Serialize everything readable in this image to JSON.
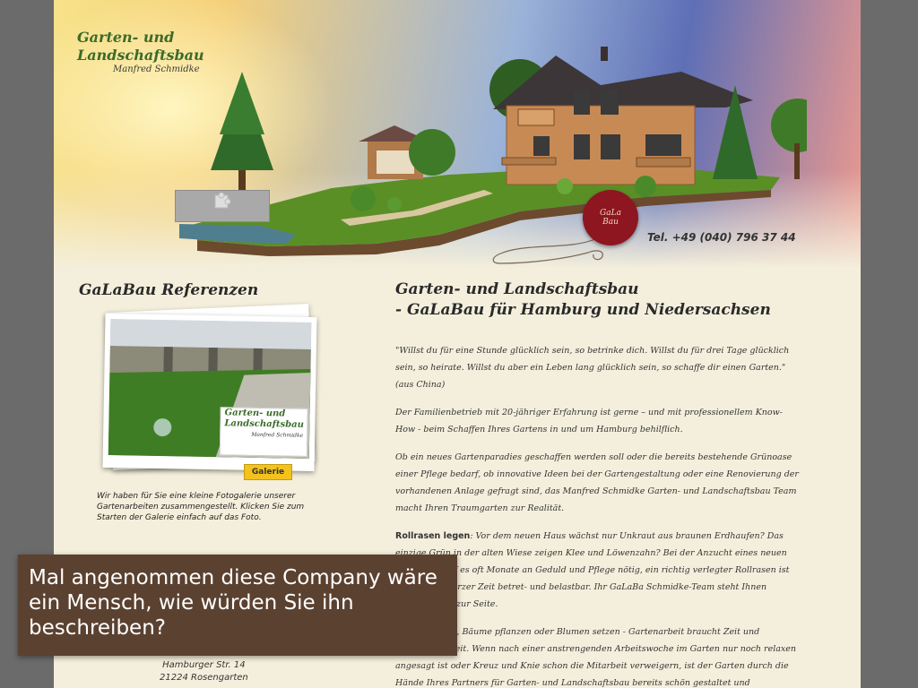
{
  "header": {
    "logo_line1": "Garten- und",
    "logo_line2": "Landschaftsbau",
    "logo_sub": "Manfred Schmidke",
    "phone": "Tel. +49 (040) 796 37 44",
    "seal_text": "GaLa Bau",
    "plugin_icon": "puzzle-icon"
  },
  "left": {
    "title": "GaLaBau Referenzen",
    "photo_logo_line1": "Garten- und",
    "photo_logo_line2": "Landschaftsbau",
    "photo_logo_sub": "Manfred Schmidke",
    "galerie_label": "Galerie",
    "description": "Wir haben für Sie eine kleine Fotogalerie unserer Gartenarbeiten zusammengestellt. Klicken Sie zum Starten der Galerie einfach auf das Foto.",
    "address_line1": "Hamburger Str. 14",
    "address_line2": "21224 Rosengarten"
  },
  "main": {
    "title_line1": "Garten- und Landschaftsbau",
    "title_line2": "- GaLaBau für Hamburg und Niedersachsen",
    "quote": "\"Willst du für eine Stunde glücklich sein, so betrinke dich. Willst du für drei Tage glücklich sein, so heirate. Willst du aber ein Leben lang glücklich sein, so schaffe dir einen Garten.\"(aus China)",
    "para1": "Der Familienbetrieb mit 20-jähriger Erfahrung ist gerne – und mit professionellem Know-How - beim Schaffen Ihres Gartens in und um Hamburg behilflich.",
    "para2": "Ob ein neues Gartenparadies geschaffen werden soll oder die bereits bestehende Grünoase einer Pflege bedarf, ob innovative Ideen bei der Gartengestaltung oder eine Renovierung der vorhandenen Anlage gefragt sind, das Manfred Schmidke Garten- und Landschaftsbau Team macht Ihren Traumgarten zur Realität.",
    "para3_bold": "Rollrasen legen",
    "para3": ": Vor dem neuen Haus wächst nur Unkraut aus braunen Erdhaufen? Das einzige Grün in der alten Wiese zeigen Klee und Löwenzahn? Bei der Anzucht eines neuen Rasens bedarf es oft Monate an Geduld und Pflege nötig, ein richtig verlegter Rollrasen ist schon nach kurzer Zeit betret- und belastbar. Ihr GaLaBa Schmidke-Team steht Ihnen hierbei gerne zur Seite.",
    "para4": ": Rasenmähen, Bäume pflanzen oder Blumen setzen - Gartenarbeit braucht Zeit und Aufmerksamkeit. Wenn nach einer anstrengenden Arbeitswoche im Garten nur noch relaxen angesagt ist oder Kreuz und Knie schon die Mitarbeit verweigern, ist der Garten durch die Hände Ihres Partners für Garten- und Landschaftsbau bereits schön gestaltet und"
  },
  "caption": {
    "text": "Mal angenommen diese Company wäre ein Mensch, wie würden Sie ihn beschreiben?"
  },
  "colors": {
    "background": "#6b6b6b",
    "page": "#f4efdc",
    "caption_bg": "#5b4130",
    "logo_green": "#3c6b2a",
    "galerie_yellow": "#f3c21c",
    "seal_red": "#8d1620"
  }
}
